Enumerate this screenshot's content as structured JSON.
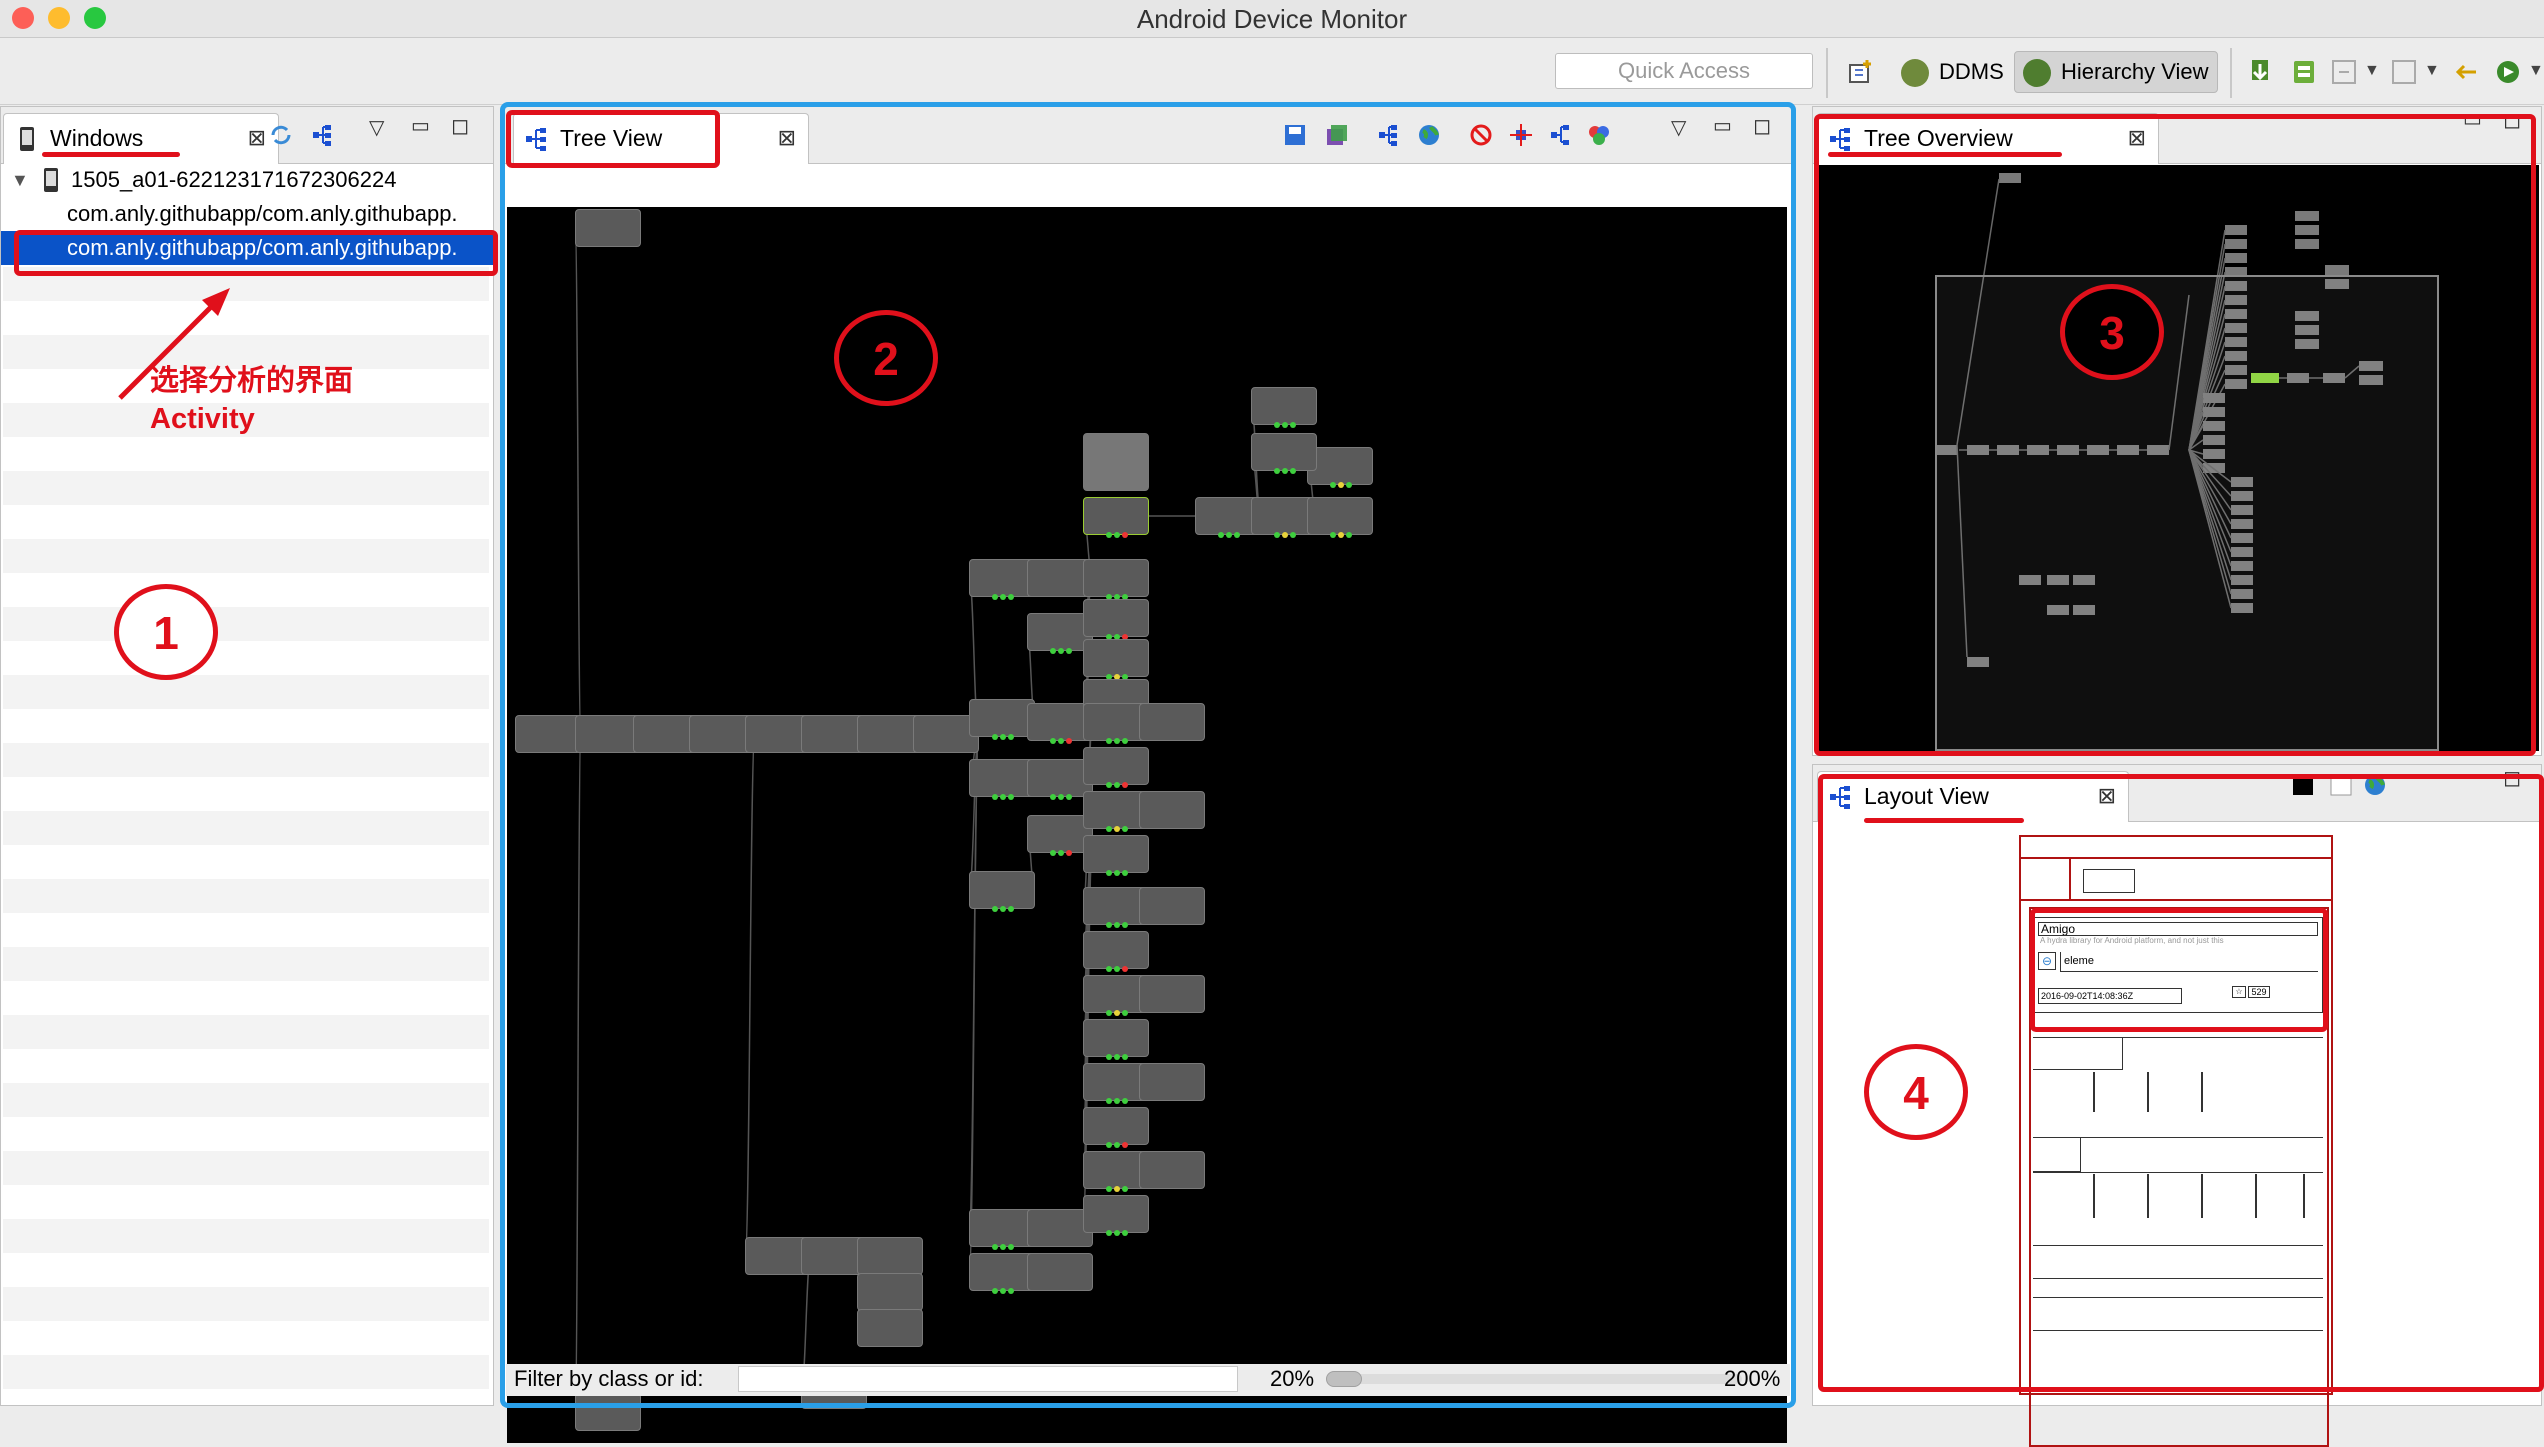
{
  "window": {
    "title": "Android Device Monitor"
  },
  "toolbar": {
    "quick_access_placeholder": "Quick Access",
    "perspectives": [
      {
        "label": "DDMS",
        "selected": false
      },
      {
        "label": "Hierarchy View",
        "selected": true
      }
    ]
  },
  "windows_view": {
    "tab_label": "Windows",
    "device": "1505_a01-622123171672306224",
    "items": [
      "com.anly.githubapp/com.anly.githubapp.",
      "com.anly.githubapp/com.anly.githubapp."
    ],
    "selected_index": 1
  },
  "tree_view": {
    "tab_label": "Tree View",
    "filter_label": "Filter by class or id:",
    "filter_value": "",
    "zoom_min": "20%",
    "zoom_max": "200%",
    "zoom_fraction": 0.0
  },
  "tree_overview": {
    "tab_label": "Tree Overview"
  },
  "layout_view": {
    "tab_label": "Layout View",
    "texts": {
      "repo_name": "Amigo",
      "repo_desc": "A hydra library for Android platform, and not just this",
      "owner": "eleme",
      "date": "2016-09-02T14:08:36Z",
      "stars": "529"
    }
  },
  "annotations": {
    "note_cn": "选择分析的界面",
    "note_en": "Activity",
    "circles": [
      "1",
      "2",
      "3",
      "4"
    ]
  },
  "colors": {
    "annotation_red": "#e0101b",
    "selection_blue": "#0a53c8",
    "focus_border": "#2a9fe8",
    "canvas": "#000000",
    "node_fill": "#5a5a5a"
  }
}
